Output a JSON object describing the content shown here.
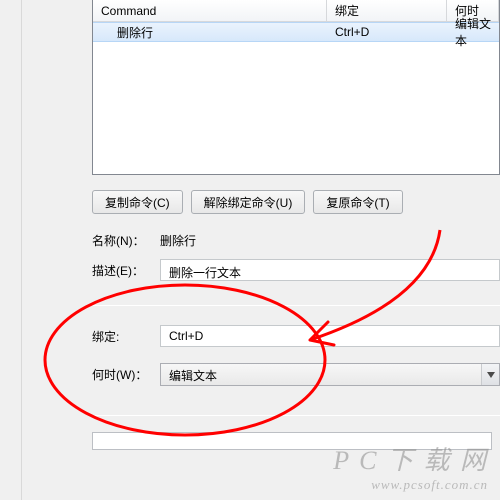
{
  "table": {
    "headers": {
      "command": "Command",
      "binding": "绑定",
      "when": "何时"
    },
    "rows": [
      {
        "command": "删除行",
        "binding": "Ctrl+D",
        "when": "编辑文本"
      }
    ]
  },
  "buttons": {
    "copy": "复制命令(C)",
    "unbind": "解除绑定命令(U)",
    "restore": "复原命令(T)"
  },
  "info": {
    "name_label": "名称(N)：",
    "name_value": "删除行",
    "desc_label": "描述(E)：",
    "desc_value": "删除一行文本"
  },
  "bind": {
    "binding_label": "绑定:",
    "binding_value": "Ctrl+D",
    "when_label": "何时(W)：",
    "when_value": "编辑文本"
  },
  "watermark": {
    "line1": "P C 下 载 网",
    "line2": "www.pcsoft.com.cn"
  }
}
